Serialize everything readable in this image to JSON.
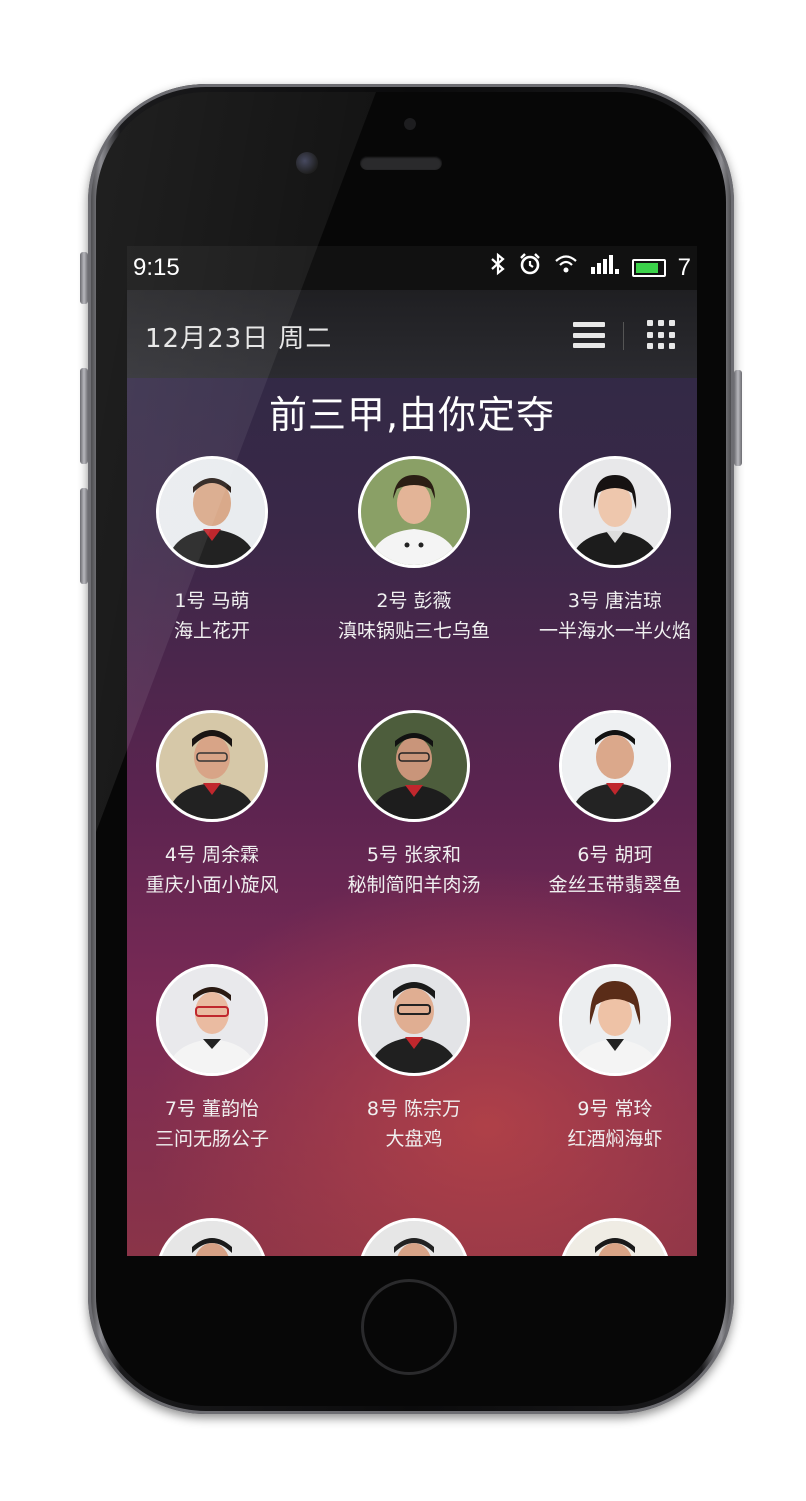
{
  "status": {
    "time": "9:15",
    "battery": "7"
  },
  "header": {
    "date": "12月23日 周二"
  },
  "headline": "前三甲,由你定夺",
  "chefs": [
    {
      "number_name": "1号 马萌",
      "dish": "海上花开"
    },
    {
      "number_name": "2号 彭薇",
      "dish": "滇味锅贴三七乌鱼"
    },
    {
      "number_name": "3号 唐洁琼",
      "dish": "一半海水一半火焰"
    },
    {
      "number_name": "4号 周余霖",
      "dish": "重庆小面小旋风"
    },
    {
      "number_name": "5号 张家和",
      "dish": "秘制简阳羊肉汤"
    },
    {
      "number_name": "6号 胡珂",
      "dish": "金丝玉带翡翠鱼"
    },
    {
      "number_name": "7号 董韵怡",
      "dish": "三问无肠公子"
    },
    {
      "number_name": "8号 陈宗万",
      "dish": "大盘鸡"
    },
    {
      "number_name": "9号 常玲",
      "dish": "红酒焖海虾"
    }
  ],
  "colors": {
    "accent_battery": "#3bd14a",
    "uniform_collar": "#c0272d"
  },
  "icons": [
    "bluetooth-icon",
    "alarm-icon",
    "wifi-icon",
    "signal-icon",
    "battery-icon",
    "list-menu-icon",
    "grid-apps-icon"
  ]
}
